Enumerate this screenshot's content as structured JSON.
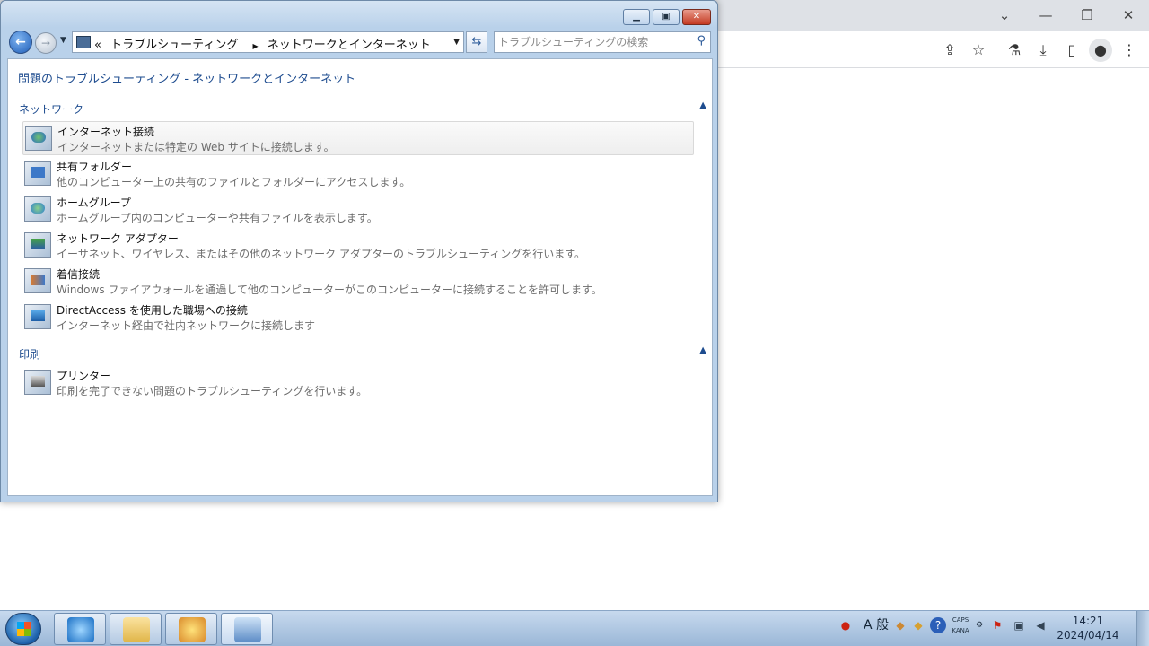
{
  "browser": {
    "toolbar_icons": [
      "share-icon",
      "star-icon",
      "extension-icon",
      "download-icon",
      "sidepanel-icon",
      "profile-icon",
      "menu-icon"
    ]
  },
  "window": {
    "address": {
      "chevrons": "«",
      "crumb1": "トラブルシューティング",
      "crumb2": "ネットワークとインターネット"
    },
    "search_placeholder": "トラブルシューティングの検索",
    "heading": "問題のトラブルシューティング - ネットワークとインターネット",
    "groups": [
      {
        "label": "ネットワーク",
        "items": [
          {
            "title": "インターネット接続",
            "desc": "インターネットまたは特定の Web サイトに接続します。"
          },
          {
            "title": "共有フォルダー",
            "desc": "他のコンピューター上の共有のファイルとフォルダーにアクセスします。"
          },
          {
            "title": "ホームグループ",
            "desc": "ホームグループ内のコンピューターや共有ファイルを表示します。"
          },
          {
            "title": "ネットワーク アダプター",
            "desc": "イーサネット、ワイヤレス、またはその他のネットワーク アダプターのトラブルシューティングを行います。"
          },
          {
            "title": "着信接続",
            "desc": "Windows ファイアウォールを通過して他のコンピューターがこのコンピューターに接続することを許可します。"
          },
          {
            "title": "DirectAccess を使用した職場への接続",
            "desc": "インターネット経由で社内ネットワークに接続します"
          }
        ]
      },
      {
        "label": "印刷",
        "items": [
          {
            "title": "プリンター",
            "desc": "印刷を完了できない問題のトラブルシューティングを行います。"
          }
        ]
      }
    ]
  },
  "taskbar": {
    "tray": {
      "ime": "A 般",
      "caps": "CAPS",
      "kana": "KANA"
    },
    "clock": {
      "time": "14:21",
      "date": "2024/04/14"
    }
  }
}
